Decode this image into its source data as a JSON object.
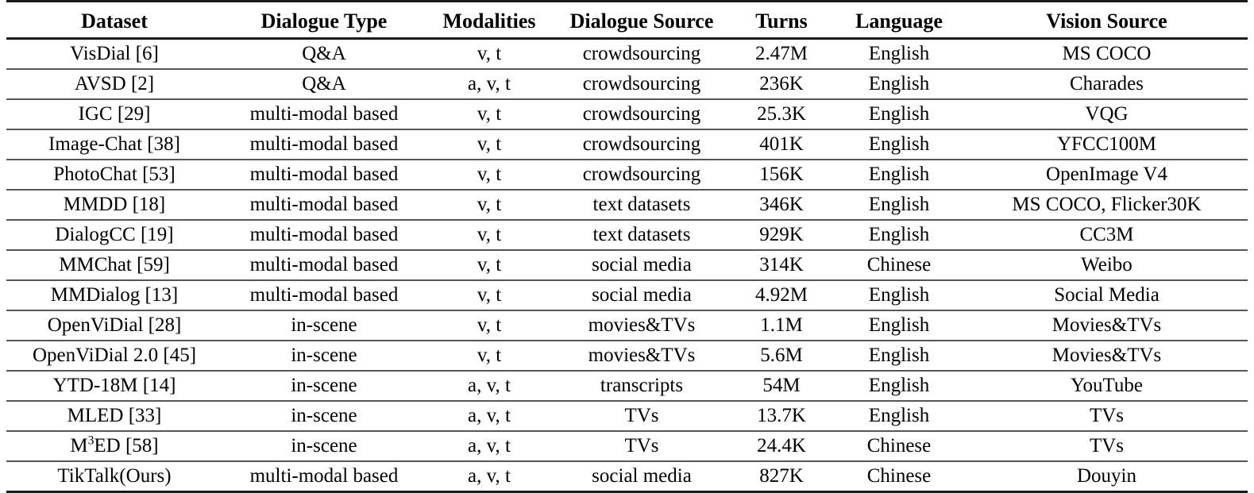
{
  "table": {
    "columns": [
      {
        "key": "dataset",
        "label": "Dataset"
      },
      {
        "key": "dialogue_type",
        "label": "Dialogue Type"
      },
      {
        "key": "modalities",
        "label": "Modalities"
      },
      {
        "key": "dialogue_source",
        "label": "Dialogue Source"
      },
      {
        "key": "turns",
        "label": "Turns"
      },
      {
        "key": "language",
        "label": "Language"
      },
      {
        "key": "vision_source",
        "label": "Vision Source"
      }
    ],
    "rows": [
      {
        "dataset": "VisDial [6]",
        "dialogue_type": "Q&A",
        "modalities": "v, t",
        "dialogue_source": "crowdsourcing",
        "turns": "2.47M",
        "language": "English",
        "vision_source": "MS COCO",
        "bold": false
      },
      {
        "dataset": "AVSD [2]",
        "dialogue_type": "Q&A",
        "modalities": "a, v, t",
        "dialogue_source": "crowdsourcing",
        "turns": "236K",
        "language": "English",
        "vision_source": "Charades",
        "bold": false
      },
      {
        "dataset": "IGC [29]",
        "dialogue_type": "multi-modal based",
        "modalities": "v, t",
        "dialogue_source": "crowdsourcing",
        "turns": "25.3K",
        "language": "English",
        "vision_source": "VQG",
        "bold": false
      },
      {
        "dataset": "Image-Chat [38]",
        "dialogue_type": "multi-modal based",
        "modalities": "v, t",
        "dialogue_source": "crowdsourcing",
        "turns": "401K",
        "language": "English",
        "vision_source": "YFCC100M",
        "bold": false
      },
      {
        "dataset": "PhotoChat [53]",
        "dialogue_type": "multi-modal based",
        "modalities": "v, t",
        "dialogue_source": "crowdsourcing",
        "turns": "156K",
        "language": "English",
        "vision_source": "OpenImage V4",
        "bold": false
      },
      {
        "dataset": "MMDD [18]",
        "dialogue_type": "multi-modal based",
        "modalities": "v, t",
        "dialogue_source": "text datasets",
        "turns": "346K",
        "language": "English",
        "vision_source": "MS COCO, Flicker30K",
        "bold": false
      },
      {
        "dataset": "DialogCC [19]",
        "dialogue_type": "multi-modal based",
        "modalities": "v, t",
        "dialogue_source": "text datasets",
        "turns": "929K",
        "language": "English",
        "vision_source": "CC3M",
        "bold": false
      },
      {
        "dataset": "MMChat [59]",
        "dialogue_type": "multi-modal based",
        "modalities": "v, t",
        "dialogue_source": "social media",
        "turns": "314K",
        "language": "Chinese",
        "vision_source": "Weibo",
        "bold": false
      },
      {
        "dataset": "MMDialog [13]",
        "dialogue_type": "multi-modal based",
        "modalities": "v, t",
        "dialogue_source": "social media",
        "turns": "4.92M",
        "language": "English",
        "vision_source": "Social Media",
        "bold": false
      },
      {
        "dataset": "OpenViDial [28]",
        "dialogue_type": "in-scene",
        "modalities": "v, t",
        "dialogue_source": "movies&TVs",
        "turns": "1.1M",
        "language": "English",
        "vision_source": "Movies&TVs",
        "bold": false
      },
      {
        "dataset": "OpenViDial 2.0 [45]",
        "dialogue_type": "in-scene",
        "modalities": "v, t",
        "dialogue_source": "movies&TVs",
        "turns": "5.6M",
        "language": "English",
        "vision_source": "Movies&TVs",
        "bold": false
      },
      {
        "dataset": "YTD-18M [14]",
        "dialogue_type": "in-scene",
        "modalities": "a, v, t",
        "dialogue_source": "transcripts",
        "turns": "54M",
        "language": "English",
        "vision_source": "YouTube",
        "bold": false
      },
      {
        "dataset": "MLED [33]",
        "dialogue_type": "in-scene",
        "modalities": "a, v, t",
        "dialogue_source": "TVs",
        "turns": "13.7K",
        "language": "English",
        "vision_source": "TVs",
        "bold": false
      },
      {
        "dataset": "M3ED [58]",
        "dataset_html": "M<sup>3</sup>ED [58]",
        "dialogue_type": "in-scene",
        "modalities": "a, v, t",
        "dialogue_source": "TVs",
        "turns": "24.4K",
        "language": "Chinese",
        "vision_source": "TVs",
        "bold": false
      },
      {
        "dataset": "TikTalk(Ours)",
        "dialogue_type": "multi-modal based",
        "modalities": "a, v, t",
        "dialogue_source": "social media",
        "turns": "827K",
        "language": "Chinese",
        "vision_source": "Douyin",
        "bold": true
      }
    ]
  },
  "style": {
    "rule_color": "#1a1a1a",
    "row_rule_color": "#575757",
    "text_color": "#000000",
    "background": "#ffffff"
  }
}
